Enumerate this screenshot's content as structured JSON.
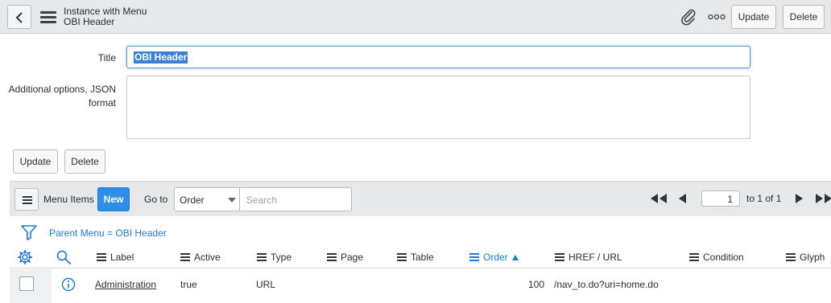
{
  "header": {
    "title": "Instance with Menu",
    "subtitle": "OBI Header",
    "update_label": "Update",
    "delete_label": "Delete"
  },
  "form": {
    "title_label": "Title",
    "title_value": "OBI Header",
    "json_label": "Additional options, JSON format",
    "json_value": "",
    "update_label": "Update",
    "delete_label": "Delete"
  },
  "related_list": {
    "name": "Menu Items",
    "new_label": "New",
    "goto_label": "Go to",
    "goto_selected": "Order",
    "search_placeholder": "Search",
    "page_value": "1",
    "page_of": "to 1 of 1",
    "breadcrumb": "Parent Menu = OBI Header",
    "columns": {
      "label": "Label",
      "active": "Active",
      "type": "Type",
      "page": "Page",
      "table": "Table",
      "order": "Order",
      "href": "HREF / URL",
      "condition": "Condition",
      "glyph": "Glyph"
    },
    "sorted_column": "order",
    "sort_direction": "ascending",
    "rows": [
      {
        "label": "Administration",
        "active": "true",
        "type": "URL",
        "page": "",
        "table": "",
        "order": "100",
        "href": "/nav_to.do?uri=home.do",
        "condition": "",
        "glyph": ""
      }
    ]
  },
  "colors": {
    "header_bg": "#e6e8ea",
    "accent": "#2f8ee5",
    "link": "#1f7ad1",
    "selection": "#3a7fd8"
  }
}
